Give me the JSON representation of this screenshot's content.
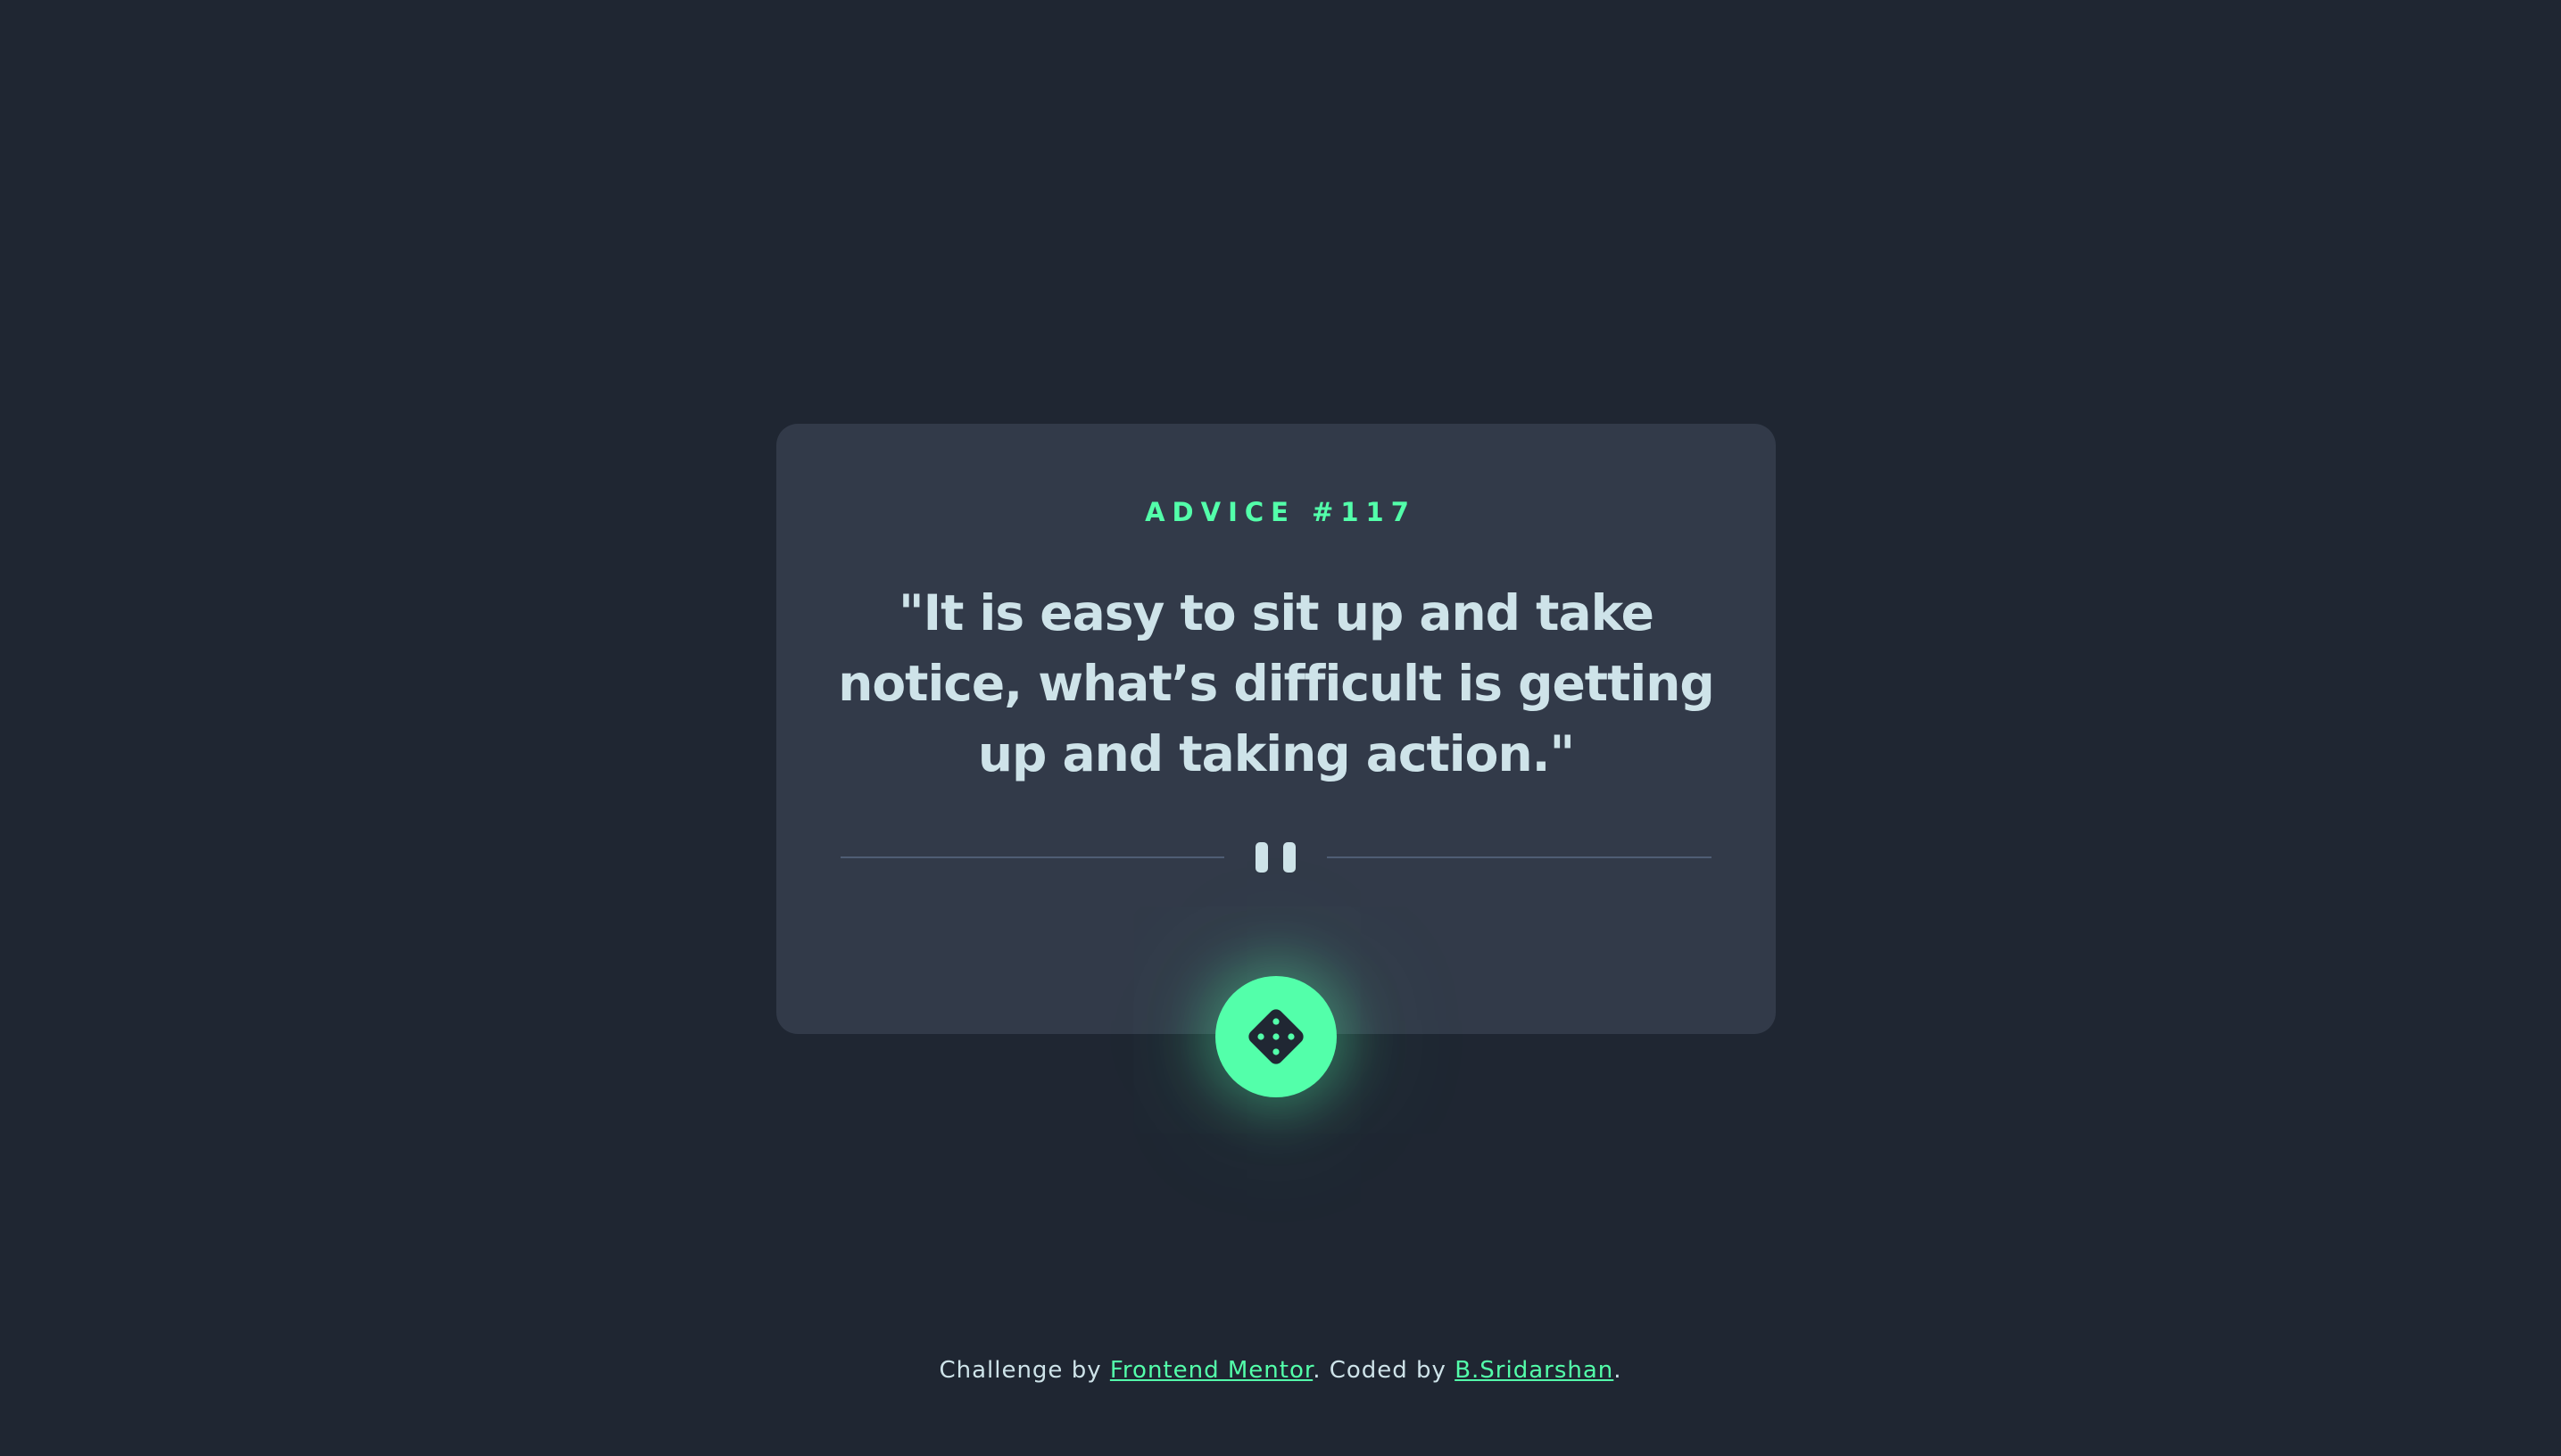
{
  "advice": {
    "title": "ADVICE #117",
    "quote": "\"It is easy to sit up and take notice, what’s difficult is getting up and taking action.\""
  },
  "divider": {
    "icon": "pause-icon"
  },
  "dice_button": {
    "icon": "dice-icon"
  },
  "attribution": {
    "prefix": "Challenge by ",
    "link1": "Frontend Mentor",
    "middle": ". Coded by ",
    "link2": "B.Sridarshan",
    "suffix": "."
  },
  "colors": {
    "background": "#1f2632",
    "card": "#323a49",
    "accent": "#53ffaa",
    "text": "#cee3e9",
    "divider": "#4f5d74"
  }
}
